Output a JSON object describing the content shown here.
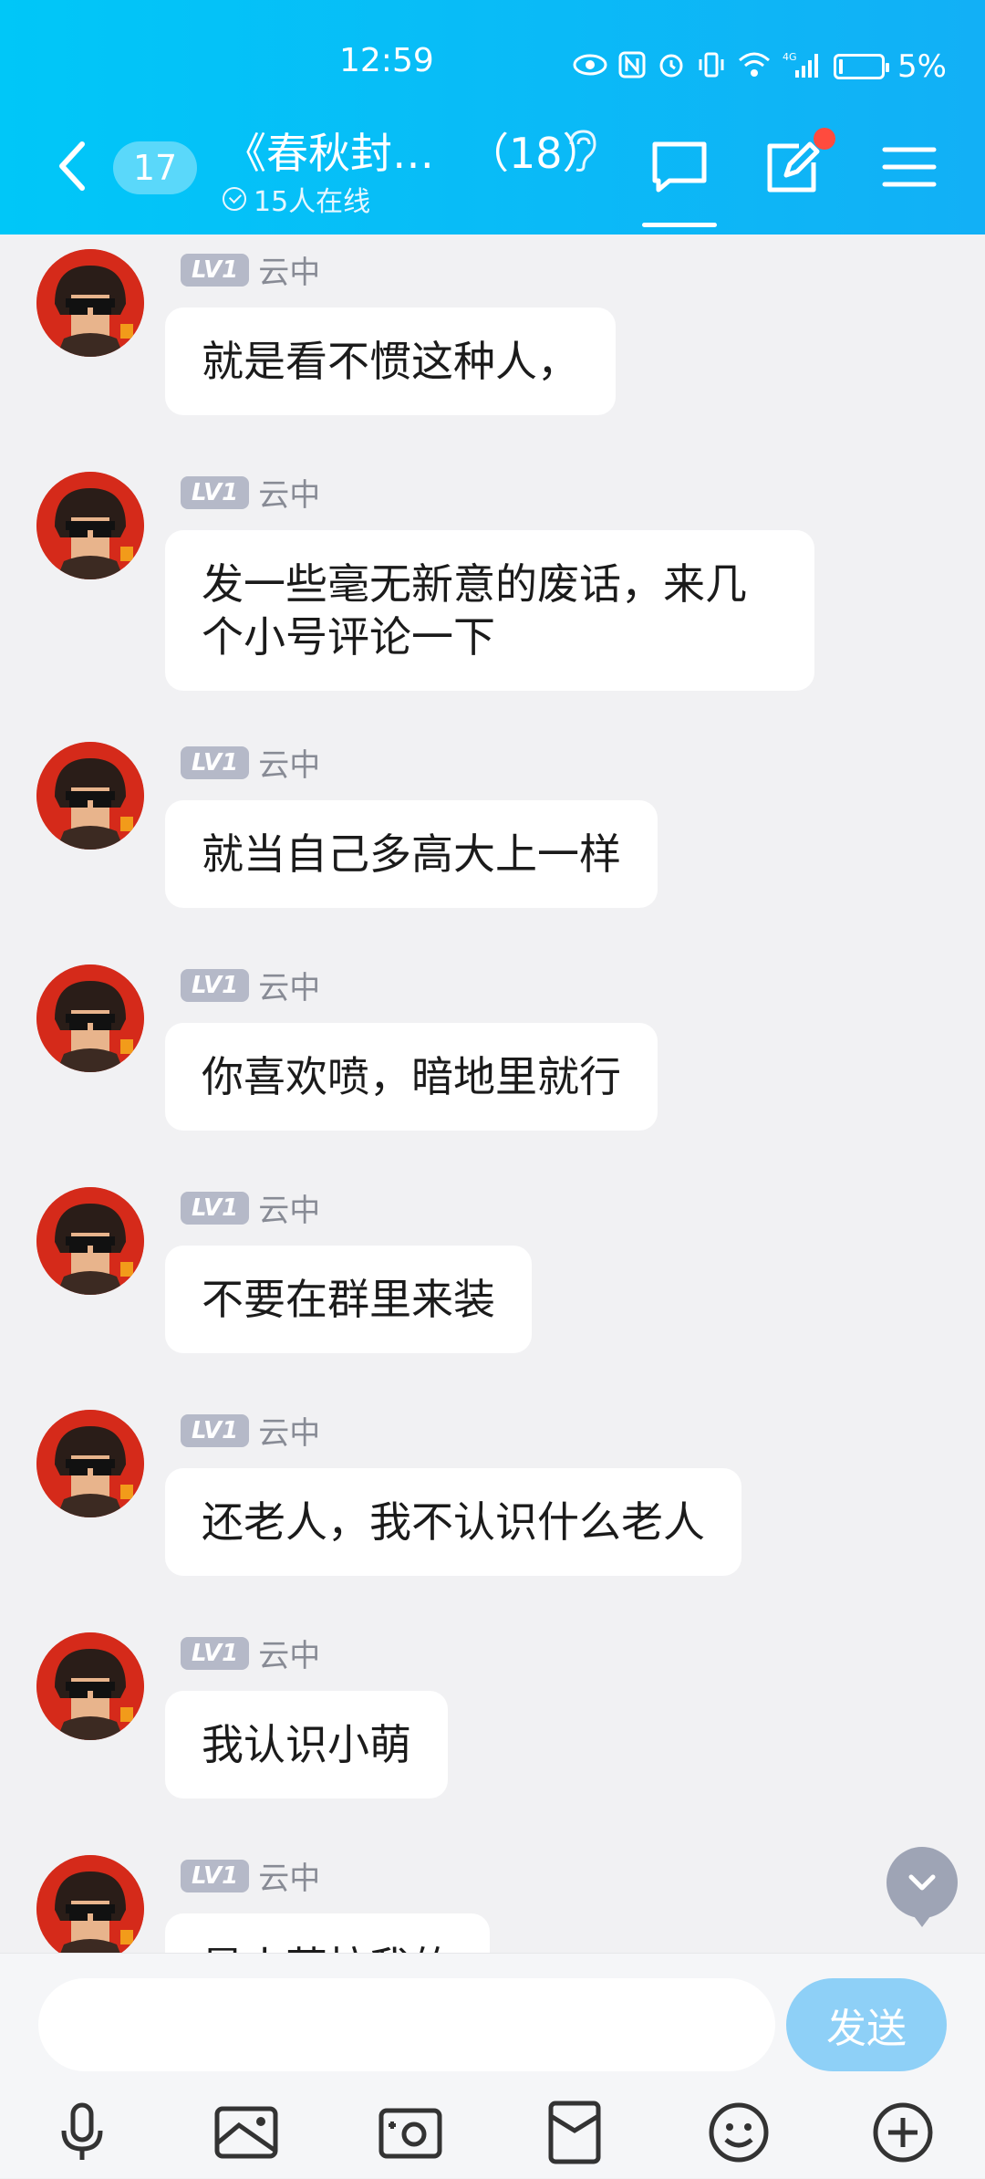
{
  "status_bar": {
    "time": "12:59",
    "battery_text": "5%",
    "network": "4G"
  },
  "header": {
    "unread_count": "17",
    "group_title": "《春秋封…",
    "member_count": "（18）",
    "online_text": "15人在线"
  },
  "messages": [
    {
      "level": "LV1",
      "name": "云中",
      "text": "就是看不惯这种人，"
    },
    {
      "level": "LV1",
      "name": "云中",
      "text": "发一些毫无新意的废话，来几个小号评论一下"
    },
    {
      "level": "LV1",
      "name": "云中",
      "text": "就当自己多高大上一样"
    },
    {
      "level": "LV1",
      "name": "云中",
      "text": "你喜欢喷，暗地里就行"
    },
    {
      "level": "LV1",
      "name": "云中",
      "text": "不要在群里来装"
    },
    {
      "level": "LV1",
      "name": "云中",
      "text": "还老人，我不认识什么老人"
    },
    {
      "level": "LV1",
      "name": "云中",
      "text": "我认识小萌"
    },
    {
      "level": "LV1",
      "name": "云中",
      "text": "是小萌拉我的"
    }
  ],
  "input": {
    "value": "",
    "send_label": "发送"
  },
  "colors": {
    "header_start": "#00c7f8",
    "header_end": "#12b0f6",
    "send_button": "#8ed0f7",
    "notification_dot": "#ff4b3e"
  }
}
